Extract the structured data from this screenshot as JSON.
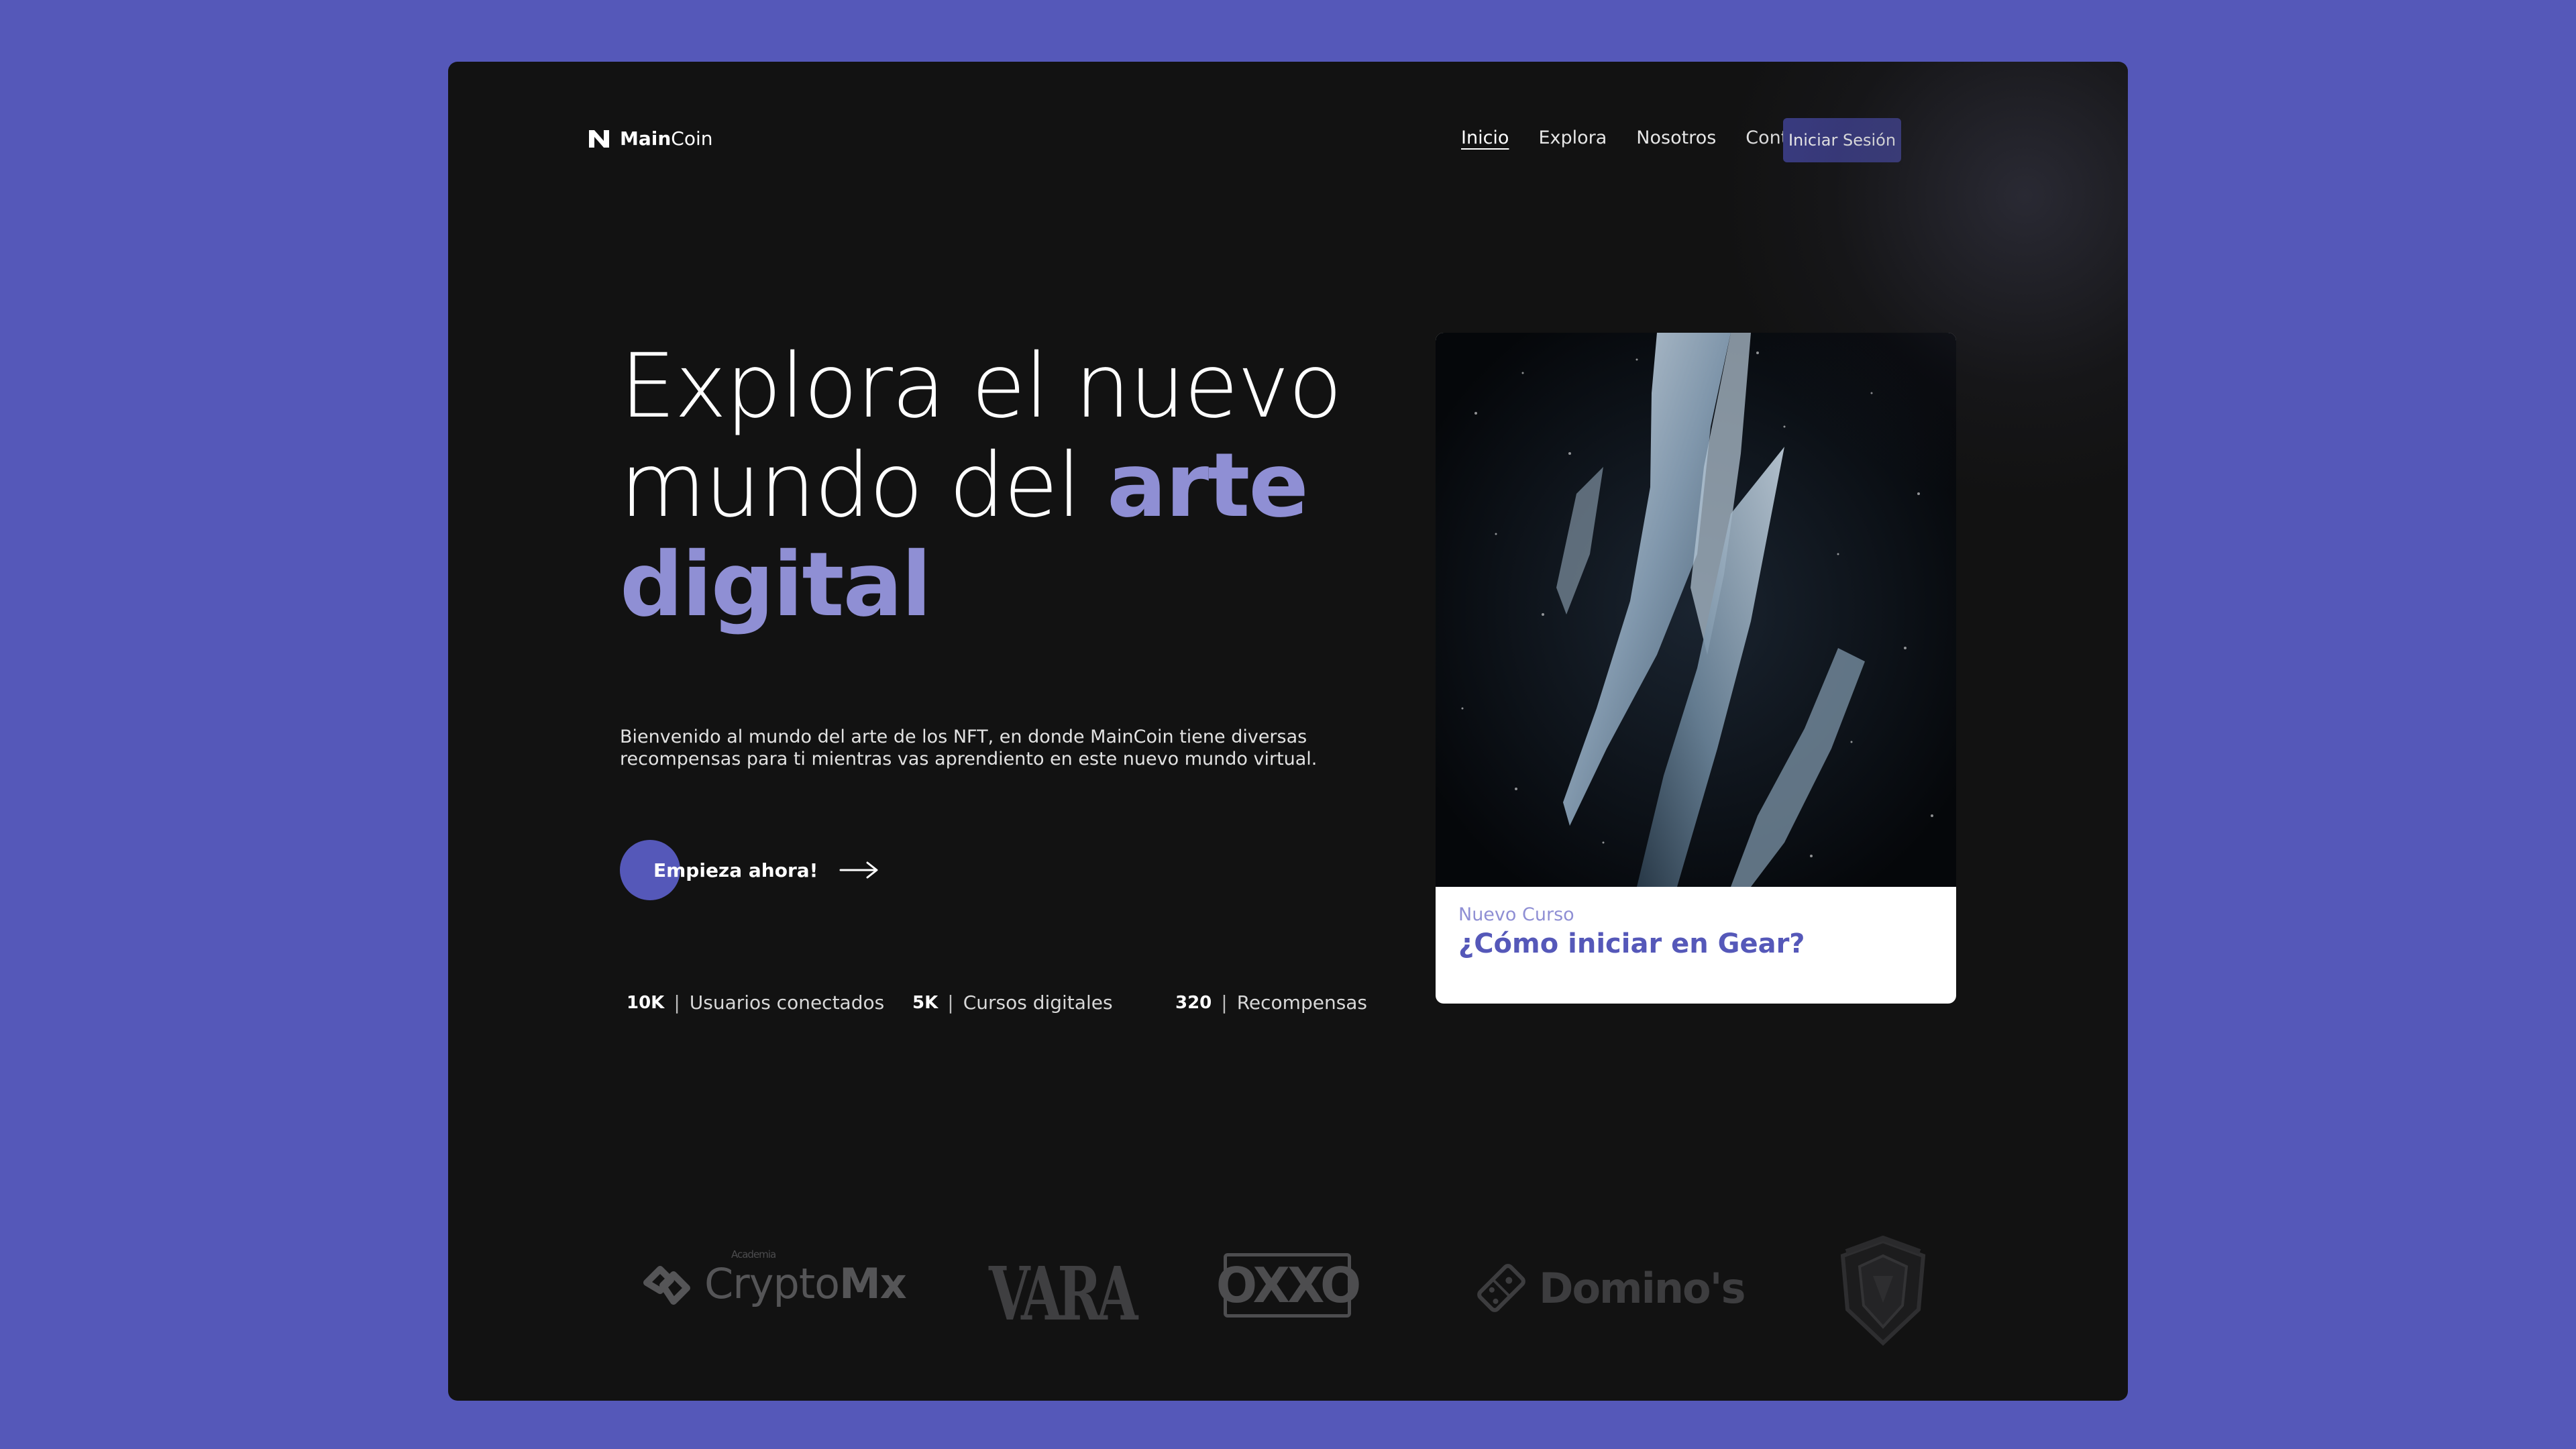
{
  "brand": {
    "name_bold": "Main",
    "name_light": "Coin"
  },
  "nav": {
    "items": [
      {
        "label": "Inicio",
        "active": true
      },
      {
        "label": "Explora",
        "active": false
      },
      {
        "label": "Nosotros",
        "active": false
      },
      {
        "label": "Contenido",
        "active": false
      }
    ],
    "login_label": "Iniciar Sesión"
  },
  "hero": {
    "headline_part1": "Explora el nuevo mundo del ",
    "headline_accent": "arte digital",
    "description": "Bienvenido al mundo del arte de los NFT, en donde MainCoin tiene diversas recompensas para ti mientras vas aprendiento en este nuevo mundo virtual.",
    "cta_label": "Empieza ahora!"
  },
  "stats": [
    {
      "value": "10K",
      "label": "Usuarios conectados"
    },
    {
      "value": "5K",
      "label": "Cursos digitales"
    },
    {
      "value": "320",
      "label": "Recompensas"
    }
  ],
  "card": {
    "kicker": "Nuevo Curso",
    "title": "¿Cómo iniciar en Gear?"
  },
  "partners": {
    "crypto_small": "Academia",
    "crypto_light": "Crypto",
    "crypto_bold": "Mx",
    "vara": "VARA",
    "oxxo": "OXXO",
    "dominos": "Domino's"
  },
  "colors": {
    "background": "#5558b9",
    "panel": "#121212",
    "accent": "#8f8fd4",
    "button": "#3a3c86"
  }
}
